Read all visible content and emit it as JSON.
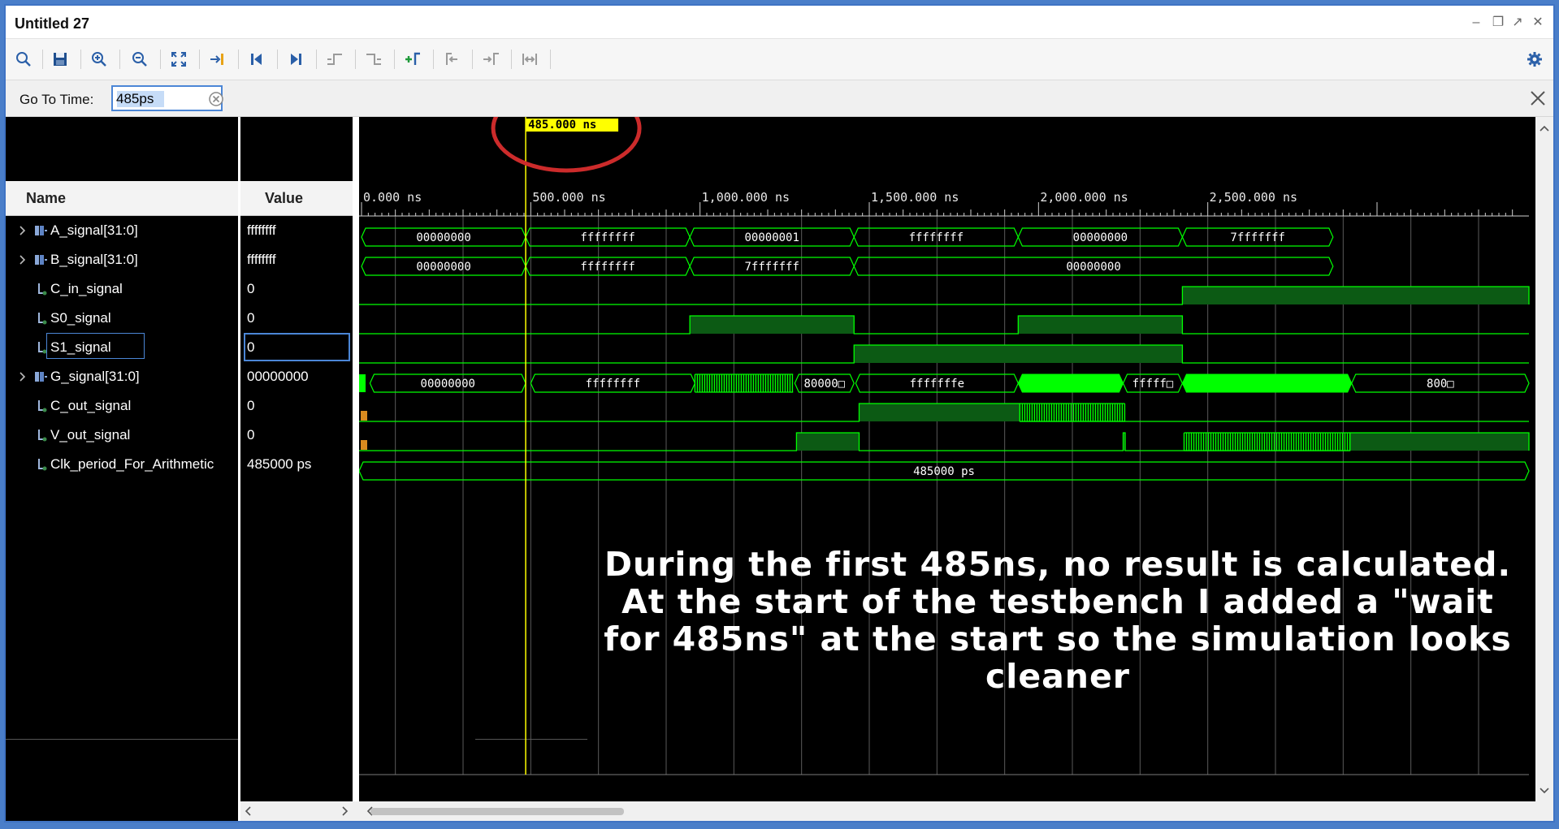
{
  "window": {
    "title": "Untitled 27"
  },
  "toolbar": {
    "buttons": [
      "search-icon",
      "save-icon",
      "zoom-in-icon",
      "zoom-out-icon",
      "zoom-fit-icon",
      "go-to-cursor-icon",
      "go-to-time-zero-icon",
      "go-to-last-time-icon",
      "previous-transition-icon",
      "next-transition-icon",
      "add-marker-icon",
      "previous-marker-icon",
      "next-marker-icon",
      "swap-cursors-icon",
      "settings-icon"
    ]
  },
  "goto": {
    "label": "Go To Time:",
    "value": "485ps"
  },
  "columns": {
    "name": "Name",
    "value": "Value"
  },
  "signals": [
    {
      "name": "A_signal[31:0]",
      "value": "ffffffff",
      "kind": "bus"
    },
    {
      "name": "B_signal[31:0]",
      "value": "ffffffff",
      "kind": "bus"
    },
    {
      "name": "C_in_signal",
      "value": "0",
      "kind": "wire"
    },
    {
      "name": "S0_signal",
      "value": "0",
      "kind": "wire"
    },
    {
      "name": "S1_signal",
      "value": "0",
      "kind": "wire"
    },
    {
      "name": "G_signal[31:0]",
      "value": "00000000",
      "kind": "bus"
    },
    {
      "name": "C_out_signal",
      "value": "0",
      "kind": "wire"
    },
    {
      "name": "V_out_signal",
      "value": "0",
      "kind": "wire"
    },
    {
      "name": "Clk_period_For_Arithmetic",
      "value": "485000 ps",
      "kind": "wire"
    }
  ],
  "cursor": {
    "label": "485.000 ns"
  },
  "ruler": [
    "0.000 ns",
    "500.000 ns",
    "1,000.000 ns",
    "1,500.000 ns",
    "2,000.000 ns",
    "2,500.000 ns"
  ],
  "waves": {
    "A": [
      "00000000",
      "ffffffff",
      "00000001",
      "ffffffff",
      "00000000",
      "7fffffff"
    ],
    "B": [
      "00000000",
      "ffffffff",
      "7fffffff",
      "00000000"
    ],
    "G": [
      "00000000",
      "ffffffff",
      "80000",
      "fffffffe",
      "fffff",
      "800"
    ],
    "clk": "485000 ps"
  },
  "annotation": [
    "During the first 485ns, no result is calculated.",
    "At the start of the testbench I added a \"wait",
    "for 485ns\" at the start so the simulation looks",
    "cleaner"
  ],
  "colors": {
    "wave": "#00ff00",
    "cursor": "#ffff00",
    "annotation_circle": "#cc2b2b",
    "selection": "#4b86d6"
  }
}
